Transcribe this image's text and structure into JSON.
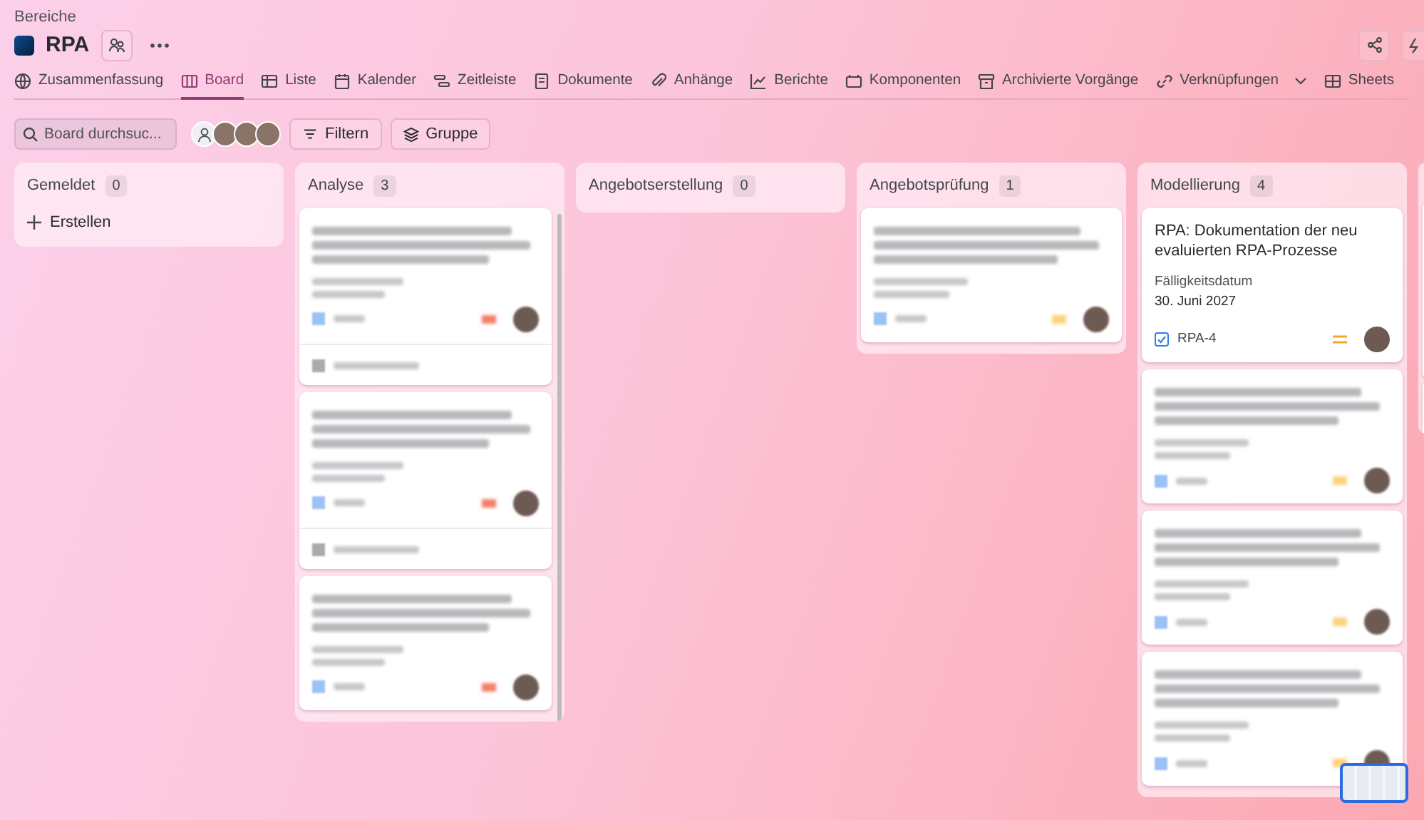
{
  "breadcrumb": "Bereiche",
  "project": {
    "title": "RPA"
  },
  "tabs": [
    {
      "label": "Zusammenfassung",
      "selected": false
    },
    {
      "label": "Board",
      "selected": true
    },
    {
      "label": "Liste",
      "selected": false
    },
    {
      "label": "Kalender",
      "selected": false
    },
    {
      "label": "Zeitleiste",
      "selected": false
    },
    {
      "label": "Dokumente",
      "selected": false
    },
    {
      "label": "Anhänge",
      "selected": false
    },
    {
      "label": "Berichte",
      "selected": false
    },
    {
      "label": "Komponenten",
      "selected": false
    },
    {
      "label": "Archivierte Vorgänge",
      "selected": false
    },
    {
      "label": "Verknüpfungen",
      "selected": false,
      "dropdown": true
    },
    {
      "label": "Sheets",
      "selected": false
    }
  ],
  "toolbar": {
    "search": {
      "placeholder": "Board durchsuc..."
    },
    "avatars": [
      {
        "kind": "generic"
      },
      {
        "kind": "photo"
      },
      {
        "kind": "photo"
      },
      {
        "kind": "photo"
      }
    ],
    "buttons": [
      "Filtern",
      "Gruppe"
    ]
  },
  "columns": [
    {
      "title": "Gemeldet",
      "count": "0",
      "create": "Erstellen"
    },
    {
      "title": "Analyse",
      "count": "3",
      "scrollbar": true,
      "cards": [
        {
          "kind": "blurred",
          "color": "#f4806a",
          "subtasks": true
        },
        {
          "kind": "blurred",
          "color": "#f4806a",
          "subtasks": true
        },
        {
          "kind": "blurred",
          "color": "#f4806a",
          "subtasks": false
        }
      ]
    },
    {
      "title": "Angebotserstellung",
      "count": "0"
    },
    {
      "title": "Angebotsprüfung",
      "count": "1",
      "cards": [
        {
          "kind": "blurred",
          "color": "#fcd37a",
          "subtasks": false
        }
      ]
    },
    {
      "title": "Modellierung",
      "count": "4",
      "cards": [
        {
          "kind": "issue",
          "title": "RPA: Dokumentation der neu evaluierten RPA-Prozesse",
          "due_label": "Fälligkeitsdatum",
          "due_date": "30. Juni 2027",
          "key": "RPA-4",
          "color": "#f5a623"
        },
        {
          "kind": "blurred",
          "color": "#fcd37a",
          "subtasks": false
        },
        {
          "kind": "blurred",
          "color": "#fcd37a",
          "subtasks": false
        },
        {
          "kind": "blurred",
          "color": "#fcd37a",
          "subtasks": false
        }
      ]
    },
    {
      "cards": [
        {
          "kind": "edge"
        },
        {
          "kind": "edge"
        }
      ]
    }
  ]
}
